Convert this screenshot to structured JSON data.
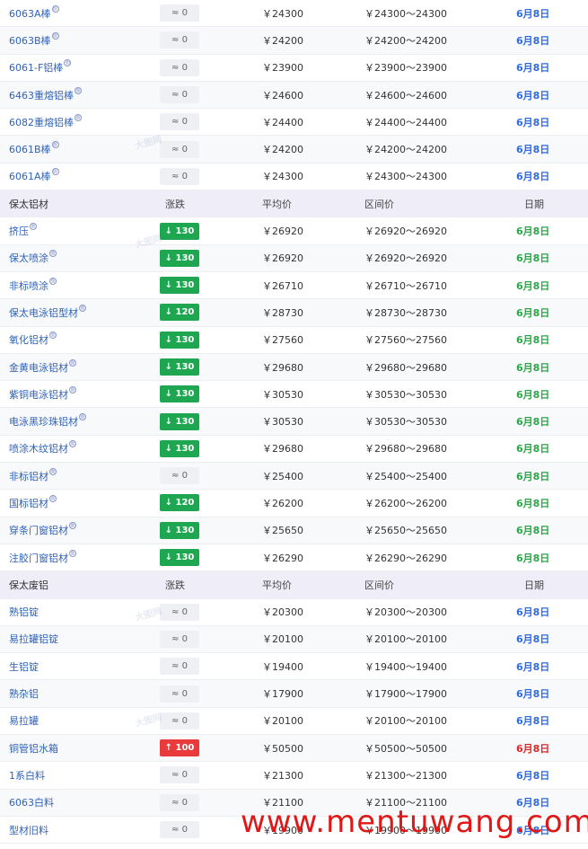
{
  "header": {
    "col_change": "涨跌",
    "col_avg": "平均价",
    "col_range": "区间价",
    "col_date": "日期"
  },
  "rows": [
    {
      "type": "item",
      "name": "6063A棒",
      "has_icon": true,
      "change": "≈ 0",
      "trend": "flat",
      "avg": "￥24300",
      "range": "￥24300～24300",
      "date": "6月8日",
      "date_color": "blue"
    },
    {
      "type": "item",
      "name": "6063B棒",
      "has_icon": true,
      "change": "≈ 0",
      "trend": "flat",
      "avg": "￥24200",
      "range": "￥24200～24200",
      "date": "6月8日",
      "date_color": "blue"
    },
    {
      "type": "item",
      "name": "6061-F铝棒",
      "has_icon": true,
      "change": "≈ 0",
      "trend": "flat",
      "avg": "￥23900",
      "range": "￥23900～23900",
      "date": "6月8日",
      "date_color": "blue"
    },
    {
      "type": "item",
      "name": "6463重熔铝棒",
      "has_icon": true,
      "change": "≈ 0",
      "trend": "flat",
      "avg": "￥24600",
      "range": "￥24600～24600",
      "date": "6月8日",
      "date_color": "blue"
    },
    {
      "type": "item",
      "name": "6082重熔铝棒",
      "has_icon": true,
      "change": "≈ 0",
      "trend": "flat",
      "avg": "￥24400",
      "range": "￥24400～24400",
      "date": "6月8日",
      "date_color": "blue"
    },
    {
      "type": "item",
      "name": "6061B棒",
      "has_icon": true,
      "change": "≈ 0",
      "trend": "flat",
      "avg": "￥24200",
      "range": "￥24200～24200",
      "date": "6月8日",
      "date_color": "blue"
    },
    {
      "type": "item",
      "name": "6061A棒",
      "has_icon": true,
      "change": "≈ 0",
      "trend": "flat",
      "avg": "￥24300",
      "range": "￥24300～24300",
      "date": "6月8日",
      "date_color": "blue"
    },
    {
      "type": "header",
      "name": "保太铝材"
    },
    {
      "type": "item",
      "name": "挤压",
      "has_icon": true,
      "change": "↓ 130",
      "trend": "down",
      "avg": "￥26920",
      "range": "￥26920～26920",
      "date": "6月8日",
      "date_color": "green"
    },
    {
      "type": "item",
      "name": "保太喷涂",
      "has_icon": true,
      "change": "↓ 130",
      "trend": "down",
      "avg": "￥26920",
      "range": "￥26920～26920",
      "date": "6月8日",
      "date_color": "green"
    },
    {
      "type": "item",
      "name": "非标喷涂",
      "has_icon": true,
      "change": "↓ 130",
      "trend": "down",
      "avg": "￥26710",
      "range": "￥26710～26710",
      "date": "6月8日",
      "date_color": "green"
    },
    {
      "type": "item",
      "name": "保太电泳铝型材",
      "has_icon": true,
      "change": "↓ 120",
      "trend": "down",
      "avg": "￥28730",
      "range": "￥28730～28730",
      "date": "6月8日",
      "date_color": "green"
    },
    {
      "type": "item",
      "name": "氧化铝材",
      "has_icon": true,
      "change": "↓ 130",
      "trend": "down",
      "avg": "￥27560",
      "range": "￥27560～27560",
      "date": "6月8日",
      "date_color": "green"
    },
    {
      "type": "item",
      "name": "金黄电泳铝材",
      "has_icon": true,
      "change": "↓ 130",
      "trend": "down",
      "avg": "￥29680",
      "range": "￥29680～29680",
      "date": "6月8日",
      "date_color": "green"
    },
    {
      "type": "item",
      "name": "紫铜电泳铝材",
      "has_icon": true,
      "change": "↓ 130",
      "trend": "down",
      "avg": "￥30530",
      "range": "￥30530～30530",
      "date": "6月8日",
      "date_color": "green"
    },
    {
      "type": "item",
      "name": "电泳黑珍珠铝材",
      "has_icon": true,
      "change": "↓ 130",
      "trend": "down",
      "avg": "￥30530",
      "range": "￥30530～30530",
      "date": "6月8日",
      "date_color": "green"
    },
    {
      "type": "item",
      "name": "喷涂木纹铝材",
      "has_icon": true,
      "change": "↓ 130",
      "trend": "down",
      "avg": "￥29680",
      "range": "￥29680～29680",
      "date": "6月8日",
      "date_color": "green"
    },
    {
      "type": "item",
      "name": "非标铝材",
      "has_icon": true,
      "change": "≈ 0",
      "trend": "flat",
      "avg": "￥25400",
      "range": "￥25400～25400",
      "date": "6月8日",
      "date_color": "green"
    },
    {
      "type": "item",
      "name": "国标铝材",
      "has_icon": true,
      "change": "↓ 120",
      "trend": "down",
      "avg": "￥26200",
      "range": "￥26200～26200",
      "date": "6月8日",
      "date_color": "green"
    },
    {
      "type": "item",
      "name": "穿条门窗铝材",
      "has_icon": true,
      "change": "↓ 130",
      "trend": "down",
      "avg": "￥25650",
      "range": "￥25650～25650",
      "date": "6月8日",
      "date_color": "green"
    },
    {
      "type": "item",
      "name": "注胶门窗铝材",
      "has_icon": true,
      "change": "↓ 130",
      "trend": "down",
      "avg": "￥26290",
      "range": "￥26290～26290",
      "date": "6月8日",
      "date_color": "green"
    },
    {
      "type": "header",
      "name": "保太废铝"
    },
    {
      "type": "item",
      "name": "熟铝锭",
      "has_icon": false,
      "change": "≈ 0",
      "trend": "flat",
      "avg": "￥20300",
      "range": "￥20300～20300",
      "date": "6月8日",
      "date_color": "blue"
    },
    {
      "type": "item",
      "name": "易拉罐铝锭",
      "has_icon": false,
      "change": "≈ 0",
      "trend": "flat",
      "avg": "￥20100",
      "range": "￥20100～20100",
      "date": "6月8日",
      "date_color": "blue"
    },
    {
      "type": "item",
      "name": "生铝锭",
      "has_icon": false,
      "change": "≈ 0",
      "trend": "flat",
      "avg": "￥19400",
      "range": "￥19400～19400",
      "date": "6月8日",
      "date_color": "blue"
    },
    {
      "type": "item",
      "name": "熟杂铝",
      "has_icon": false,
      "change": "≈ 0",
      "trend": "flat",
      "avg": "￥17900",
      "range": "￥17900～17900",
      "date": "6月8日",
      "date_color": "blue"
    },
    {
      "type": "item",
      "name": "易拉罐",
      "has_icon": false,
      "change": "≈ 0",
      "trend": "flat",
      "avg": "￥20100",
      "range": "￥20100～20100",
      "date": "6月8日",
      "date_color": "blue"
    },
    {
      "type": "item",
      "name": "铜管铝水箱",
      "has_icon": false,
      "change": "↑ 100",
      "trend": "up",
      "avg": "￥50500",
      "range": "￥50500～50500",
      "date": "6月8日",
      "date_color": "red"
    },
    {
      "type": "item",
      "name": "1系白料",
      "has_icon": false,
      "change": "≈ 0",
      "trend": "flat",
      "avg": "￥21300",
      "range": "￥21300～21300",
      "date": "6月8日",
      "date_color": "blue"
    },
    {
      "type": "item",
      "name": "6063白料",
      "has_icon": false,
      "change": "≈ 0",
      "trend": "flat",
      "avg": "￥21100",
      "range": "￥21100～21100",
      "date": "6月8日",
      "date_color": "blue"
    },
    {
      "type": "item",
      "name": "型材旧料",
      "has_icon": false,
      "change": "≈ 0",
      "trend": "flat",
      "avg": "￥19900",
      "range": "￥19900～19900",
      "date": "6月8日",
      "date_color": "blue"
    }
  ],
  "watermark_text": "大图网",
  "footer_watermark": "www.mentuwang.com",
  "colors": {
    "blue_link": "#2f63b9",
    "date_blue": "#2d6be3",
    "date_green": "#27a845",
    "date_red": "#e02424",
    "down_badge": "#1fa650",
    "up_badge": "#e93b3b",
    "header_bg": "#efedf8"
  }
}
